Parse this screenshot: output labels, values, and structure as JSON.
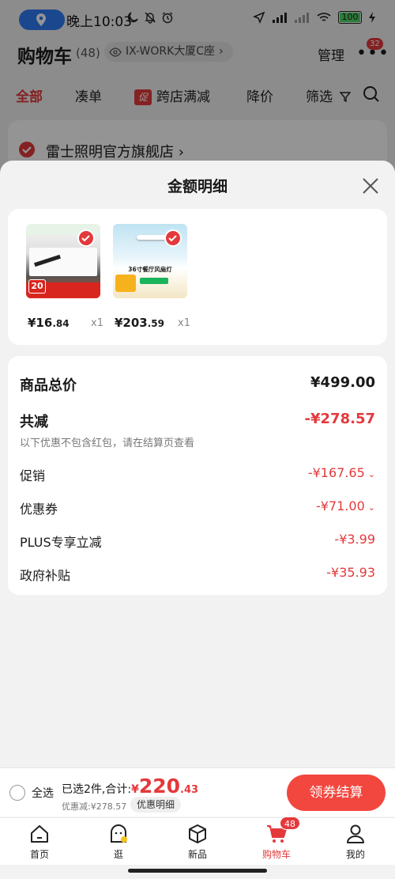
{
  "status_bar": {
    "time": "晚上10:03",
    "battery": "100"
  },
  "cart": {
    "title": "购物车",
    "count": "(48)",
    "address": "IX-WORK大厦C座",
    "manage": "管理",
    "message_badge": "32",
    "tabs": [
      "全部",
      "凑单",
      "跨店满减",
      "降价",
      "筛选"
    ],
    "promo_tag": "促",
    "store_name": "雷士照明官方旗舰店"
  },
  "sheet": {
    "title": "金额明细",
    "products": [
      {
        "price_main": "¥16",
        "price_decimal": ".84",
        "qty": "x1",
        "image_text": "20"
      },
      {
        "price_main": "¥203",
        "price_decimal": ".59",
        "qty": "x1",
        "image_text": "36寸餐厅风扇灯"
      }
    ],
    "rows": {
      "goods_total_label": "商品总价",
      "goods_total_value": "¥499.00",
      "total_reduce_label": "共减",
      "total_reduce_value": "-¥278.57",
      "note": "以下优惠不包含红包，请在结算页查看",
      "promo_label": "促销",
      "promo_value": "-¥167.65",
      "coupon_label": "优惠券",
      "coupon_value": "-¥71.00",
      "plus_label": "PLUS专享立减",
      "plus_value": "-¥3.99",
      "subsidy_label": "政府补贴",
      "subsidy_value": "-¥35.93"
    }
  },
  "checkout": {
    "select_all": "全选",
    "selected_text": "已选2件,合计:",
    "total_symbol": "¥",
    "total_main": "220",
    "total_decimal": ".43",
    "discount_text": "优惠减:¥278.57",
    "detail_pill": "优惠明细",
    "button": "领券结算"
  },
  "nav": {
    "items": [
      "首页",
      "逛",
      "新品",
      "购物车",
      "我的"
    ],
    "cart_badge": "48"
  },
  "colors": {
    "accent": "#e4393c",
    "checkout_button": "#f2473e"
  }
}
